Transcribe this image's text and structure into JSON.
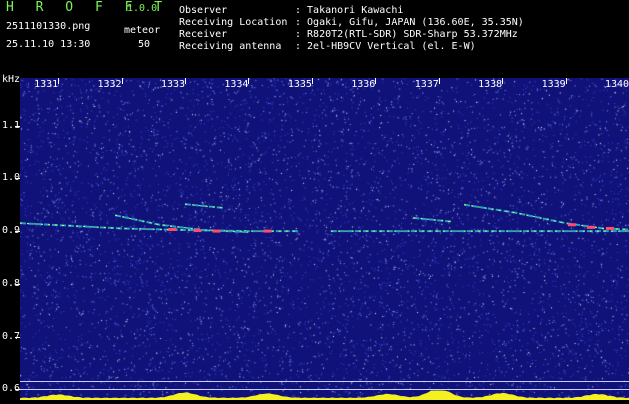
{
  "app": {
    "title": "H R O F F T",
    "version": "1.0.0"
  },
  "file": {
    "name": "2511101330.png",
    "datetime": "25.11.10 13:30",
    "meteor_label": "meteor",
    "meteor_count": "50"
  },
  "info": {
    "observer_label": "Observer",
    "observer_value": ": Takanori Kawachi",
    "location_label": "Receiving Location",
    "location_value": ": Ogaki, Gifu, JAPAN (136.60E, 35.35N)",
    "receiver_label": "Receiver",
    "receiver_value": ": R820T2(RTL-SDR) SDR-Sharp 53.372MHz",
    "antenna_label": "Receiving antenna",
    "antenna_value": ": 2el-HB9CV Vertical (el. E-W)"
  },
  "chart_data": {
    "type": "heatmap",
    "y_unit_label": "kHz",
    "y_ticks": [
      "1.1",
      "1.0",
      "0.9",
      "0.8",
      "0.7",
      "0.6"
    ],
    "x_ticks": [
      "1331",
      "1332",
      "1333",
      "1334",
      "1335",
      "1336",
      "1337",
      "1338",
      "1339",
      "1340"
    ],
    "x_range": [
      1330.4,
      1340
    ],
    "y_range": [
      0.58,
      1.19
    ],
    "colors": {
      "background": "#10127a",
      "noise": "#ffffff",
      "carrier": "#1ea0c8",
      "echo_strong": "#ff4a6a",
      "echo": "#d4f25a",
      "baseline_fill": "#f5f020"
    },
    "traces": [
      {
        "points": [
          [
            1330.4,
            0.915
          ],
          [
            1331.2,
            0.91
          ],
          [
            1332.0,
            0.905
          ],
          [
            1333.0,
            0.902
          ],
          [
            1334.0,
            0.9
          ],
          [
            1334.8,
            0.9
          ]
        ]
      },
      {
        "points": [
          [
            1331.9,
            0.93
          ],
          [
            1332.6,
            0.912
          ],
          [
            1333.3,
            0.902
          ],
          [
            1334.0,
            0.898
          ]
        ]
      },
      {
        "points": [
          [
            1333.0,
            0.951
          ],
          [
            1333.6,
            0.944
          ]
        ]
      },
      {
        "points": [
          [
            1335.3,
            0.9
          ],
          [
            1340.0,
            0.9
          ]
        ]
      },
      {
        "points": [
          [
            1337.4,
            0.95
          ],
          [
            1338.2,
            0.935
          ],
          [
            1339.0,
            0.915
          ],
          [
            1339.6,
            0.905
          ],
          [
            1340.0,
            0.903
          ]
        ]
      },
      {
        "points": [
          [
            1336.6,
            0.925
          ],
          [
            1337.2,
            0.918
          ]
        ]
      }
    ],
    "strong_echoes": [
      {
        "x": 1332.8,
        "y": 0.903
      },
      {
        "x": 1333.2,
        "y": 0.901
      },
      {
        "x": 1333.5,
        "y": 0.9
      },
      {
        "x": 1334.3,
        "y": 0.9
      },
      {
        "x": 1339.1,
        "y": 0.912
      },
      {
        "x": 1339.4,
        "y": 0.907
      },
      {
        "x": 1339.7,
        "y": 0.905
      }
    ],
    "reference_lines": [
      0.615,
      0.6
    ],
    "baseline_peaks": [
      {
        "x": 1331.0,
        "level": 0.35
      },
      {
        "x": 1333.0,
        "level": 0.55
      },
      {
        "x": 1334.3,
        "level": 0.45
      },
      {
        "x": 1336.2,
        "level": 0.4
      },
      {
        "x": 1337.0,
        "level": 0.95
      },
      {
        "x": 1338.0,
        "level": 0.5
      },
      {
        "x": 1339.5,
        "level": 0.4
      }
    ]
  }
}
